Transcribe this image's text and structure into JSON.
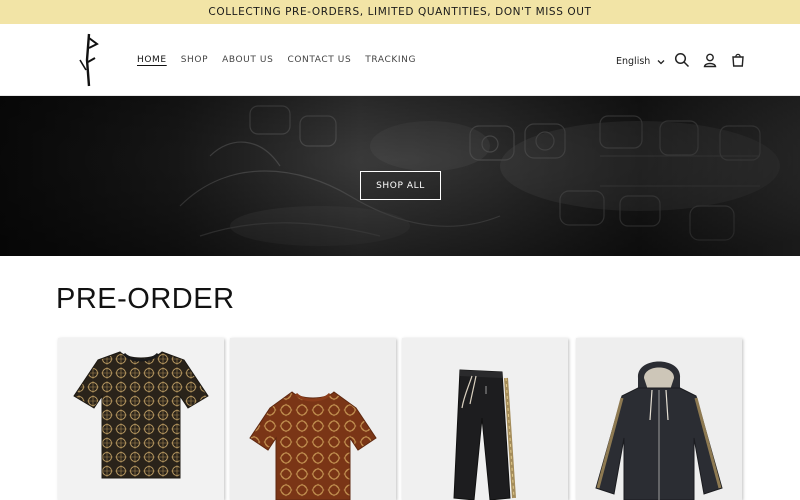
{
  "announcement": {
    "text": "COLLECTING PRE-ORDERS, LIMITED QUANTITIES, DON'T MISS OUT"
  },
  "header": {
    "nav": [
      {
        "label": "HOME",
        "active": true
      },
      {
        "label": "SHOP"
      },
      {
        "label": "ABOUT US"
      },
      {
        "label": "CONTACT US"
      },
      {
        "label": "TRACKING"
      }
    ],
    "language": "English",
    "icons": [
      "search-icon",
      "account-icon",
      "cart-icon",
      "chevron-down-icon"
    ]
  },
  "hero": {
    "button_label": "SHOP ALL"
  },
  "section": {
    "title": "PRE-ORDER"
  },
  "products": [
    {
      "image": "patterned-tshirt-black-gold"
    },
    {
      "image": "patterned-tshirt-rust-gold"
    },
    {
      "image": "black-joggers-gold-stripe"
    },
    {
      "image": "black-zip-hoodie"
    }
  ],
  "colors": {
    "announcement_bg": "#f2e4a6",
    "text": "#121212"
  }
}
